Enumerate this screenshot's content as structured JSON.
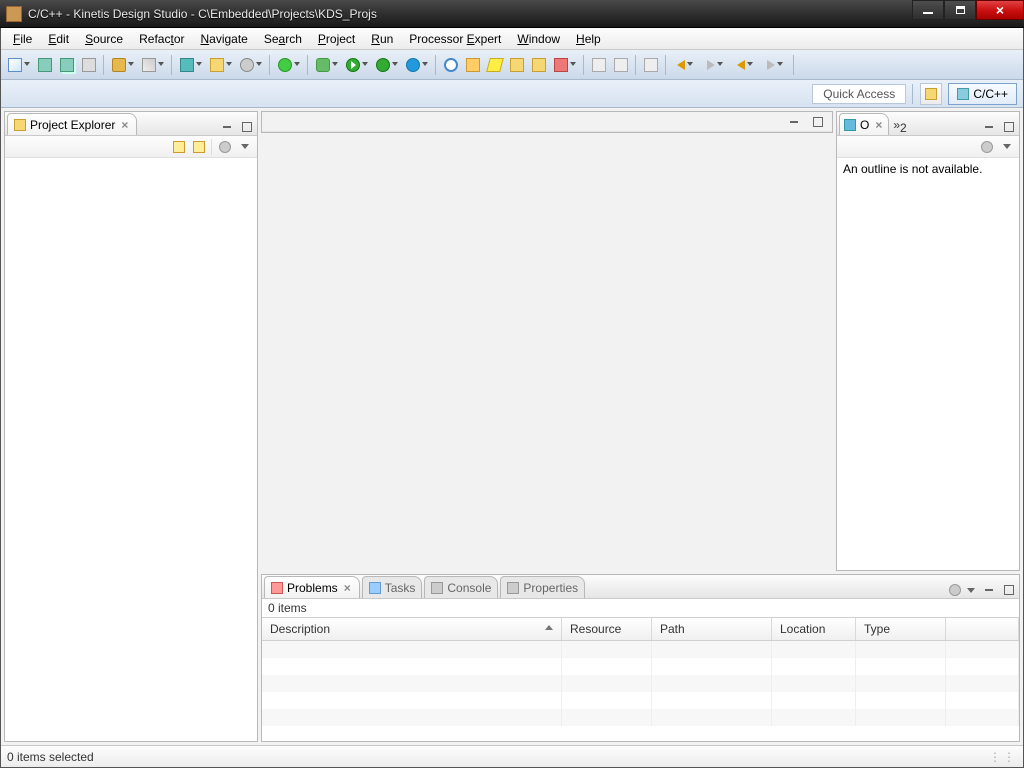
{
  "window": {
    "title": "C/C++ - Kinetis Design Studio - C\\Embedded\\Projects\\KDS_Projs"
  },
  "menus": [
    "File",
    "Edit",
    "Source",
    "Refactor",
    "Navigate",
    "Search",
    "Project",
    "Run",
    "Processor Expert",
    "Window",
    "Help"
  ],
  "menu_mnemonic_index": [
    0,
    0,
    0,
    5,
    0,
    3,
    0,
    0,
    10,
    0,
    0
  ],
  "perspective": {
    "quick_access": "Quick Access",
    "current": "C/C++"
  },
  "project_explorer": {
    "tab_label": "Project Explorer"
  },
  "outline": {
    "tab_label": "O",
    "more_indicator": "»",
    "more_count": "2",
    "body": "An outline is not available."
  },
  "problems": {
    "tabs": [
      "Problems",
      "Tasks",
      "Console",
      "Properties"
    ],
    "summary": "0 items",
    "columns": [
      "Description",
      "Resource",
      "Path",
      "Location",
      "Type"
    ]
  },
  "status": {
    "text": "0 items selected"
  }
}
